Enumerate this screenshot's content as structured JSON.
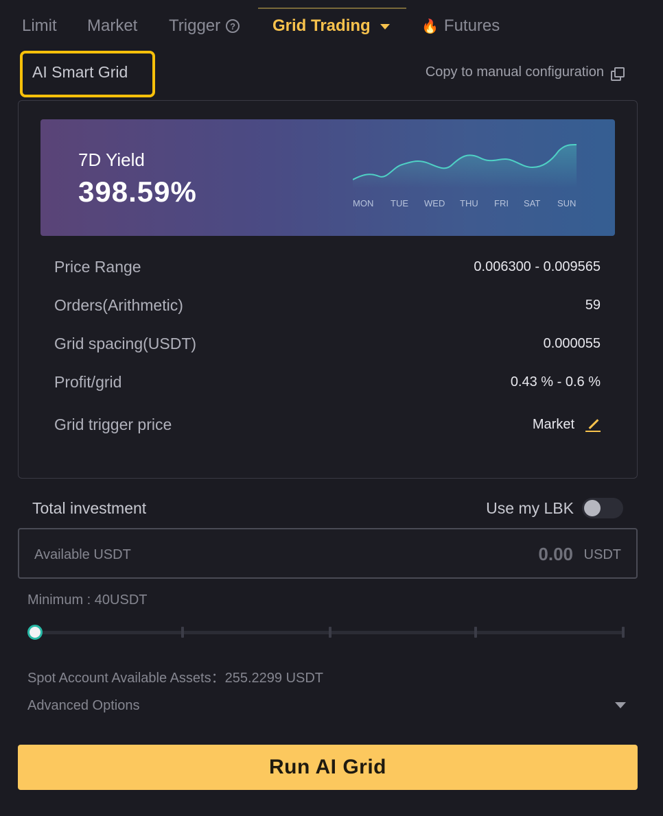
{
  "tabs": [
    {
      "label": "Limit"
    },
    {
      "label": "Market"
    },
    {
      "label": "Trigger"
    },
    {
      "label": "Grid Trading"
    },
    {
      "label": "Futures"
    }
  ],
  "header": {
    "title": "AI Smart Grid",
    "copy_link": "Copy to manual configuration"
  },
  "yield": {
    "label": "7D Yield",
    "value": "398.59%",
    "days": [
      "MON",
      "TUE",
      "WED",
      "THU",
      "FRI",
      "SAT",
      "SUN"
    ]
  },
  "info": [
    {
      "label": "Price Range",
      "value": "0.006300 - 0.009565"
    },
    {
      "label": "Orders(Arithmetic)",
      "value": "59"
    },
    {
      "label": "Grid spacing(USDT)",
      "value": "0.000055"
    },
    {
      "label": "Profit/grid",
      "value": "0.43 % - 0.6 %"
    },
    {
      "label": "Grid trigger price",
      "value": "Market"
    }
  ],
  "investment": {
    "title": "Total investment",
    "use_lbk_label": "Use my LBK",
    "use_lbk_enabled": false,
    "available_label": "Available USDT",
    "amount": "0.00",
    "unit": "USDT",
    "minimum": "Minimum : 40USDT",
    "slider_value_percent": 0,
    "spot_assets": "Spot Account Available Assets：255.2299 USDT",
    "advanced_options": "Advanced Options"
  },
  "run_button": "Run AI Grid",
  "colors": {
    "accent": "#f7c24d",
    "highlight_border": "#f7c00a",
    "button": "#fcc85e",
    "spark_line": "#4fd1c5"
  }
}
